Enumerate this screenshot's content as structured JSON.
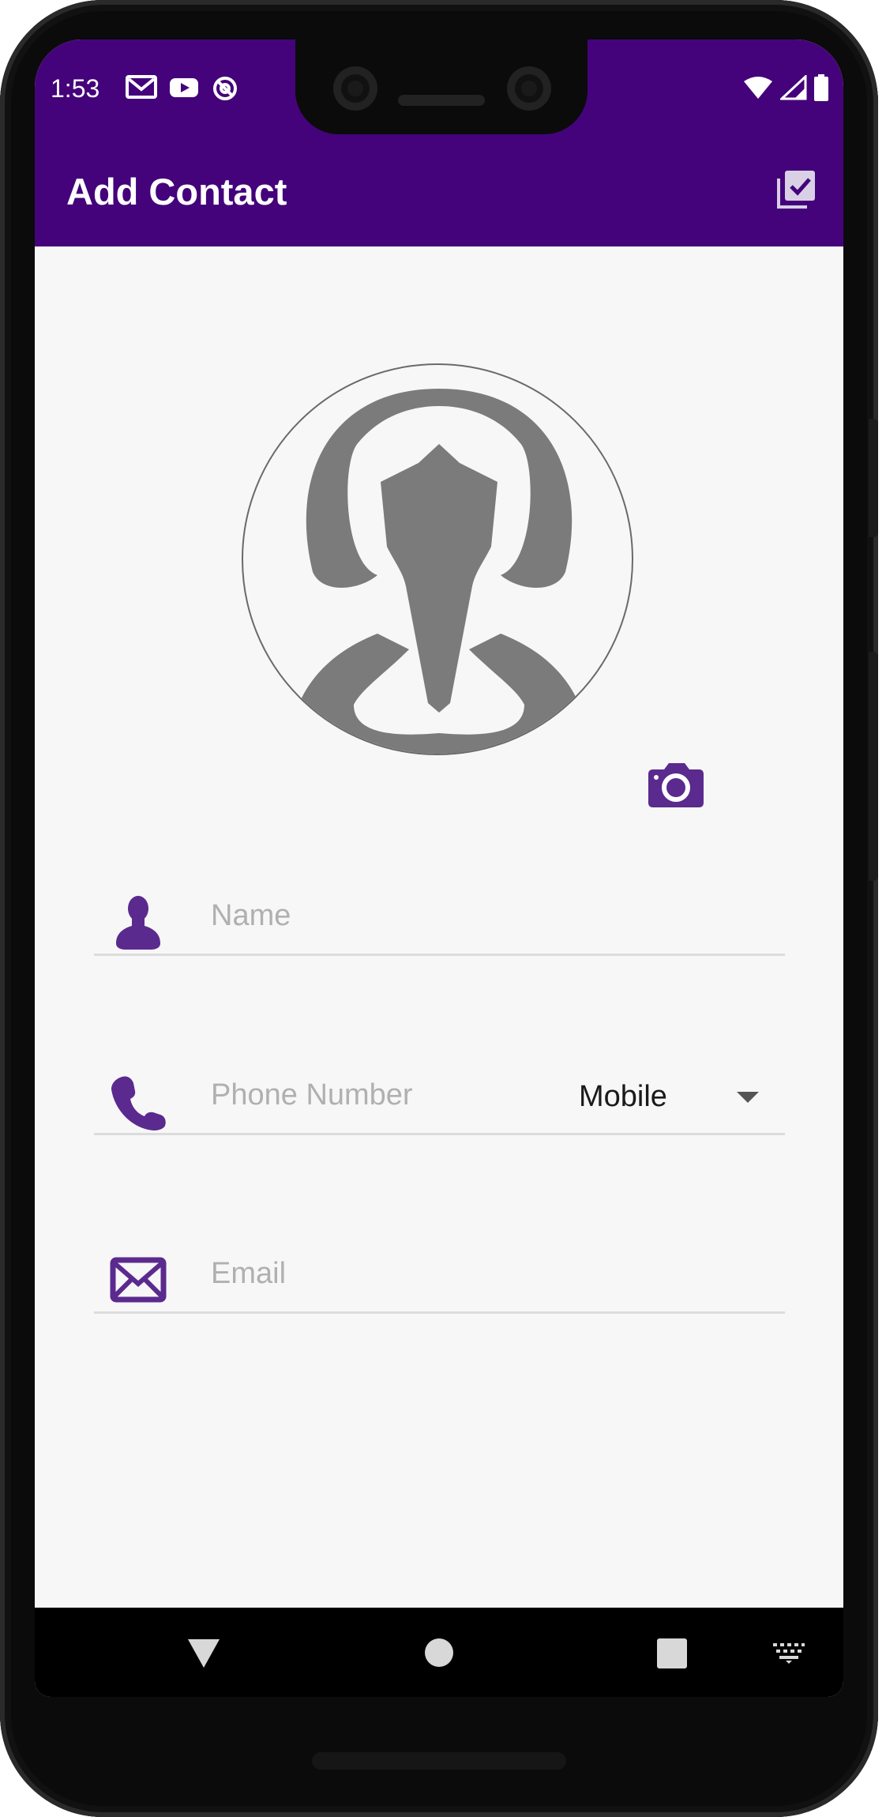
{
  "status_bar": {
    "time": "1:53",
    "left_icons": [
      "gmail-icon",
      "youtube-icon",
      "data-saver-icon"
    ],
    "right_icons": [
      "wifi-icon",
      "signal-icon",
      "battery-icon"
    ]
  },
  "app_bar": {
    "title": "Add Contact",
    "action_icon": "save-check-icon"
  },
  "avatar": {
    "icon": "person-placeholder-icon"
  },
  "camera_button": {
    "icon": "camera-icon"
  },
  "form": {
    "name": {
      "icon": "person-icon",
      "placeholder": "Name",
      "value": ""
    },
    "phone": {
      "icon": "phone-icon",
      "placeholder": "Phone Number",
      "value": "",
      "type_selected": "Mobile"
    },
    "email": {
      "icon": "mail-icon",
      "placeholder": "Email",
      "value": ""
    }
  },
  "navigation": {
    "buttons": [
      "back",
      "home",
      "recents",
      "keyboard"
    ]
  },
  "colors": {
    "app_bar": "#44037a",
    "accent": "#5b2a8e",
    "background": "#f7f7f7",
    "divider": "#dcdcdc",
    "placeholder": "#b0b0b0"
  }
}
